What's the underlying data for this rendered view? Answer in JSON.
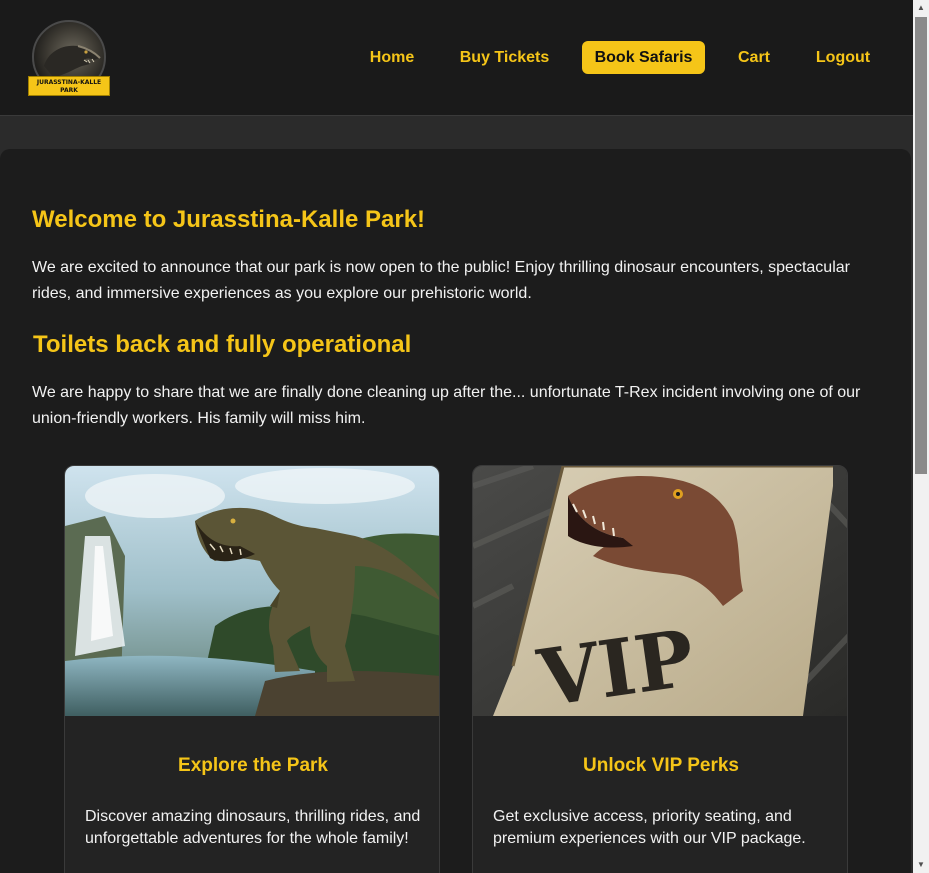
{
  "logo": {
    "text": "JURASSTINA-KALLE PARK"
  },
  "nav": {
    "items": [
      {
        "label": "Home"
      },
      {
        "label": "Buy Tickets"
      },
      {
        "label": "Book Safaris"
      },
      {
        "label": "Cart"
      },
      {
        "label": "Logout"
      }
    ],
    "active": "Book Safaris"
  },
  "main": {
    "welcome_title": "Welcome to Jurasstina-Kalle Park!",
    "welcome_text": "We are excited to announce that our park is now open to the public! Enjoy thrilling dinosaur encounters, spectacular rides, and immersive experiences as you explore our prehistoric world.",
    "news_title": "Toilets back and fully operational",
    "news_text": "We are happy to share that we are finally done cleaning up after the... unfortunate T-Rex incident involving one of our union-friendly workers. His family will miss him."
  },
  "cards": [
    {
      "title": "Explore the Park",
      "text": "Discover amazing dinosaurs, thrilling rides, and unforgettable adventures for the whole family!"
    },
    {
      "title": "Unlock VIP Perks",
      "text": "Get exclusive access, priority seating, and premium experiences with our VIP package.",
      "image_text": "VIP"
    }
  ],
  "colors": {
    "accent": "#f5c518",
    "header_bg": "#1a1a1a",
    "panel_bg": "#1c1c1c",
    "page_bg": "#2b2b2b"
  },
  "icons": {
    "scroll_up": "▲",
    "scroll_down": "▼"
  }
}
